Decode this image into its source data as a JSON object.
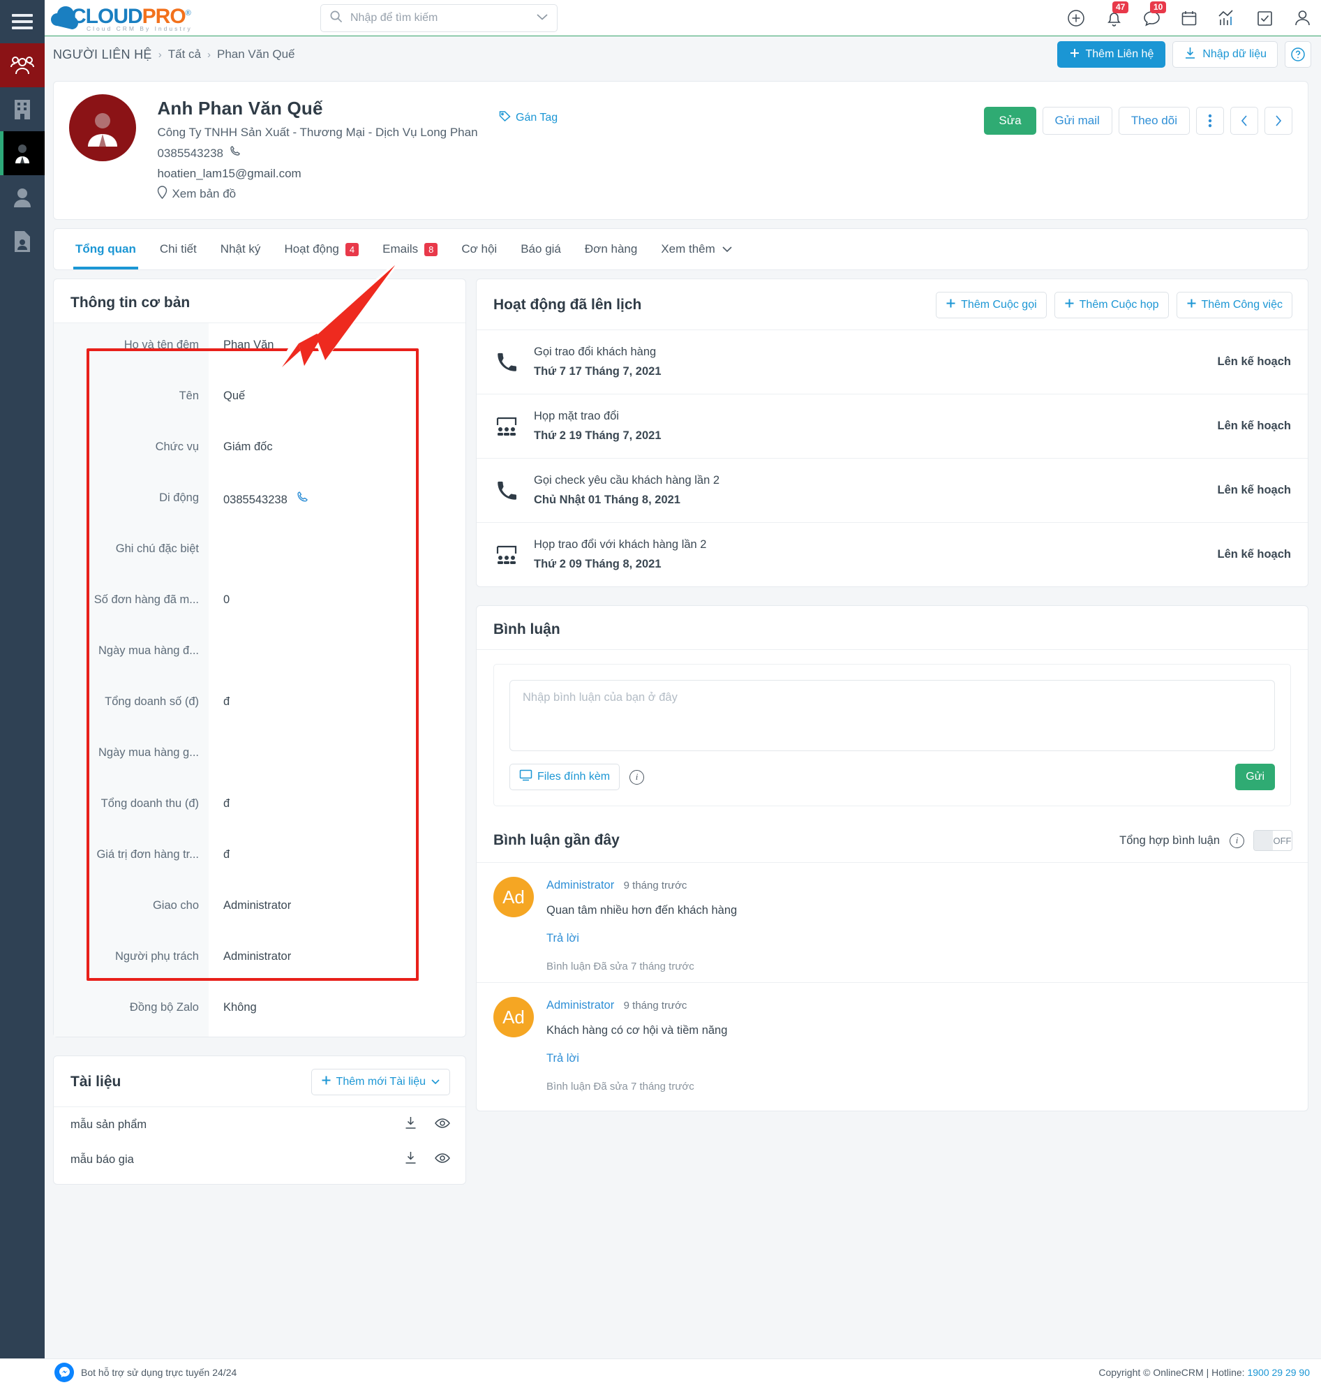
{
  "brand": {
    "name_cloud": "CLOUD",
    "name_pro": "PRO",
    "reg": "®",
    "tagline": "Cloud CRM By Industry"
  },
  "search": {
    "placeholder": "Nhập để tìm kiếm"
  },
  "topbar": {
    "icons": [
      {
        "name": "add-circle-icon",
        "badge": ""
      },
      {
        "name": "bell-icon",
        "badge": "47"
      },
      {
        "name": "chat-icon",
        "badge": "10"
      },
      {
        "name": "calendar-icon",
        "badge": ""
      },
      {
        "name": "analytics-icon",
        "badge": ""
      },
      {
        "name": "task-check-icon",
        "badge": ""
      },
      {
        "name": "user-icon",
        "badge": ""
      }
    ],
    "bell_badge": "47",
    "chat_badge": "10"
  },
  "breadcrumb": {
    "root": "NGƯỜI LIÊN HỆ",
    "sep": "›",
    "all": "Tất cả",
    "current": "Phan Văn Quế"
  },
  "crumb_actions": {
    "add_contact": "Thêm Liên hệ",
    "import": "Nhập dữ liệu",
    "help": "?"
  },
  "contact": {
    "name": "Anh Phan Văn Quế",
    "company": "Công Ty TNHH Sản Xuất - Thương Mại - Dịch Vụ Long Phan",
    "phone": "0385543238",
    "email": "hoatien_lam15@gmail.com",
    "map_link": "Xem bản đồ",
    "tag_link": "Gán Tag",
    "actions": {
      "edit": "Sửa",
      "send_mail": "Gửi mail",
      "follow": "Theo dõi",
      "more": "⋮",
      "prev": "‹",
      "next": "›"
    }
  },
  "tabs": [
    {
      "label": "Tổng quan",
      "count": "",
      "active": true
    },
    {
      "label": "Chi tiết",
      "count": "",
      "active": false
    },
    {
      "label": "Nhật ký",
      "count": "",
      "active": false
    },
    {
      "label": "Hoạt động",
      "count": "4",
      "active": false
    },
    {
      "label": "Emails",
      "count": "8",
      "active": false
    },
    {
      "label": "Cơ hội",
      "count": "",
      "active": false
    },
    {
      "label": "Báo giá",
      "count": "",
      "active": false
    },
    {
      "label": "Đơn hàng",
      "count": "",
      "active": false
    },
    {
      "label": "Xem thêm",
      "count": "",
      "active": false,
      "caret": true
    }
  ],
  "basic_info": {
    "title": "Thông tin cơ bản",
    "rows": [
      {
        "label": "Họ và tên đệm",
        "value": "Phan Văn"
      },
      {
        "label": "Tên",
        "value": "Quế"
      },
      {
        "label": "Chức vụ",
        "value": "Giám đốc"
      },
      {
        "label": "Di động",
        "value": "0385543238",
        "phone_icon": true
      },
      {
        "label": "Ghi chú đặc biệt",
        "value": ""
      },
      {
        "label": "Số đơn hàng đã m...",
        "value": "0"
      },
      {
        "label": "Ngày mua hàng đ...",
        "value": ""
      },
      {
        "label": "Tổng doanh số (đ)",
        "value": "đ"
      },
      {
        "label": "Ngày mua hàng g...",
        "value": ""
      },
      {
        "label": "Tổng doanh thu (đ)",
        "value": "đ"
      },
      {
        "label": "Giá trị đơn hàng tr...",
        "value": "đ"
      },
      {
        "label": "Giao cho",
        "value": "Administrator"
      },
      {
        "label": "Người phụ trách",
        "value": "Administrator"
      },
      {
        "label": "Đồng bộ Zalo",
        "value": "Không"
      }
    ]
  },
  "documents": {
    "title": "Tài liệu",
    "add_button": "Thêm mới Tài liệu",
    "items": [
      {
        "name": "mẫu sản phẩm"
      },
      {
        "name": "mẫu báo gia"
      }
    ]
  },
  "activities": {
    "title": "Hoạt động đã lên lịch",
    "buttons": [
      {
        "label": "Thêm Cuộc gọi"
      },
      {
        "label": "Thêm Cuộc họp"
      },
      {
        "label": "Thêm Công việc"
      }
    ],
    "items": [
      {
        "icon": "phone-icon",
        "title": "Gọi trao đổi khách hàng",
        "date": "Thứ 7 17 Tháng 7, 2021",
        "status": "Lên kế hoạch"
      },
      {
        "icon": "meeting-icon",
        "title": "Họp mặt trao đổi",
        "date": "Thứ 2 19 Tháng 7, 2021",
        "status": "Lên kế hoạch"
      },
      {
        "icon": "phone-icon",
        "title": "Gọi check yêu cầu khách hàng lần 2",
        "date": "Chủ Nhật 01 Tháng 8, 2021",
        "status": "Lên kế hoạch"
      },
      {
        "icon": "meeting-icon",
        "title": "Họp trao đổi với khách hàng lần 2",
        "date": "Thứ 2 09 Tháng 8, 2021",
        "status": "Lên kế hoạch"
      }
    ]
  },
  "comments": {
    "title": "Bình luận",
    "input_placeholder": "Nhập bình luận của bạn ở đây",
    "attach_label": "Files đính kèm",
    "send_label": "Gửi",
    "recent_title": "Bình luận gần đây",
    "aggregate_label": "Tổng hợp bình luận",
    "toggle_state": "OFF",
    "items": [
      {
        "avatar": "Ad",
        "author": "Administrator",
        "when": "9 tháng trước",
        "text": "Quan tâm nhiều hơn đến khách hàng",
        "reply": "Trả lời",
        "edited": "Bình luận Đã sửa 7 tháng trước"
      },
      {
        "avatar": "Ad",
        "author": "Administrator",
        "when": "9 tháng trước",
        "text": "Khách hàng có cơ hội và tiềm năng",
        "reply": "Trả lời",
        "edited": "Bình luận Đã sửa 7 tháng trước"
      }
    ]
  },
  "footer": {
    "left": "Bot hỗ trợ sử dụng trực tuyến 24/24",
    "copyright": "Copyright © OnlineCRM | Hotline: ",
    "hotline": "1900 29 29 90"
  },
  "sidebar_rail": [
    {
      "name": "sidebar-contacts-group",
      "state": "active-red"
    },
    {
      "name": "sidebar-companies",
      "state": ""
    },
    {
      "name": "sidebar-contact-person",
      "state": "active-black"
    },
    {
      "name": "sidebar-leads",
      "state": ""
    },
    {
      "name": "sidebar-documents",
      "state": ""
    }
  ],
  "colors": {
    "brand_blue": "#1b96d4",
    "green": "#2fab73",
    "rail": "#2f4154",
    "red_accent": "#8b1316",
    "badge_red": "#e8394a",
    "highlight_box": "#e8201a"
  }
}
